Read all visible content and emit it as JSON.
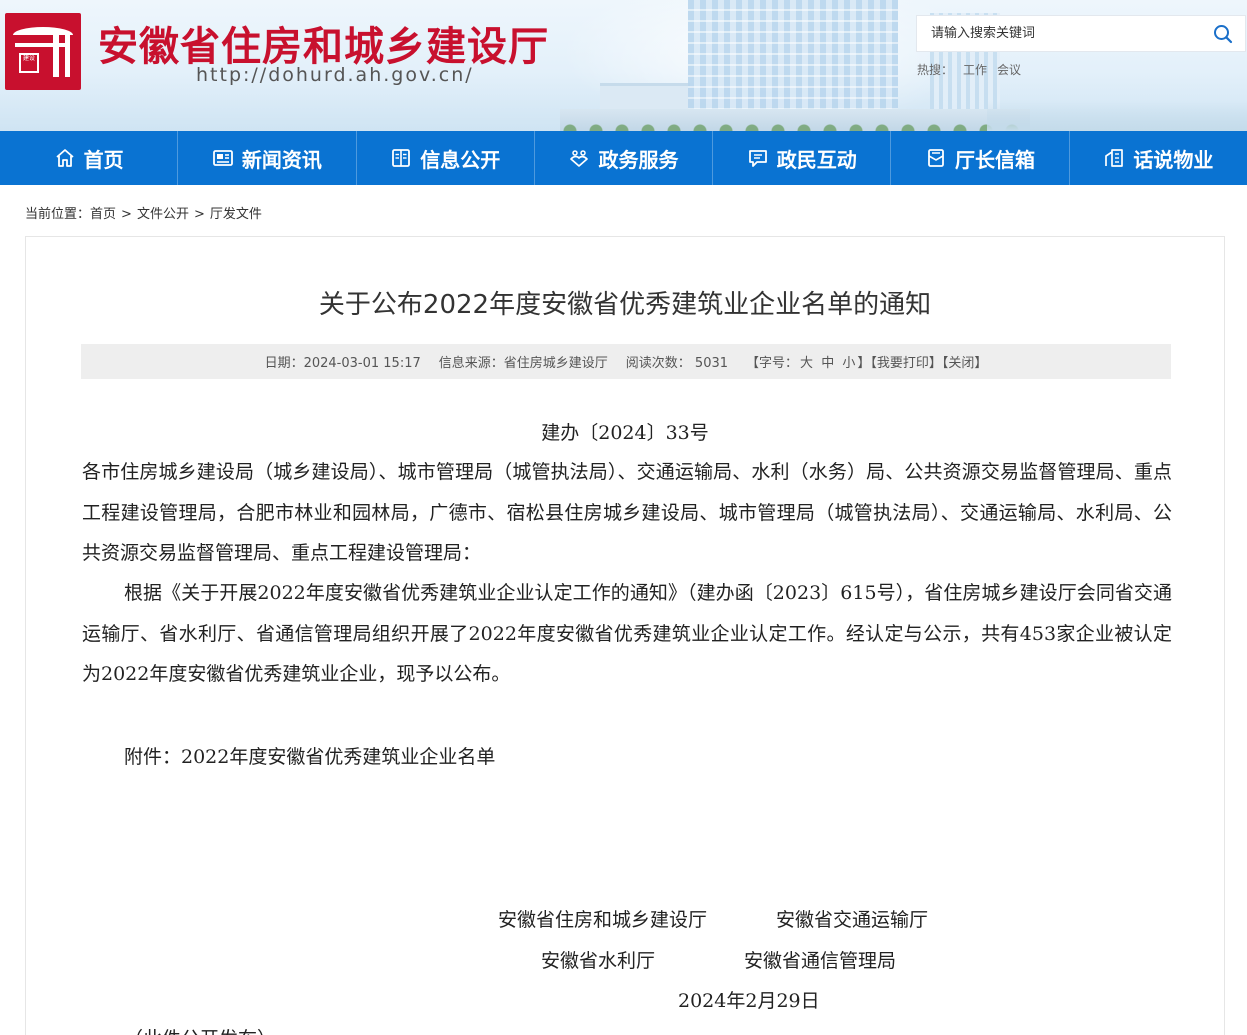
{
  "header": {
    "site_title": "安徽省住房和城乡建设厅",
    "site_url": "http://dohurd.ah.gov.cn/",
    "logo_seal_text": "建设",
    "search": {
      "placeholder": "请输入搜索关键词",
      "icon": "search-icon"
    },
    "hot": {
      "label": "热搜：",
      "items": [
        "工作",
        "会议"
      ]
    }
  },
  "nav": {
    "items": [
      {
        "label": "首页",
        "icon": "home-icon"
      },
      {
        "label": "新闻资讯",
        "icon": "news-icon"
      },
      {
        "label": "信息公开",
        "icon": "document-icon"
      },
      {
        "label": "政务服务",
        "icon": "service-icon"
      },
      {
        "label": "政民互动",
        "icon": "chat-icon"
      },
      {
        "label": "厅长信箱",
        "icon": "mailbox-icon"
      },
      {
        "label": "话说物业",
        "icon": "building-icon"
      }
    ],
    "colors": {
      "bar": "#0a73d2",
      "text": "#ffffff"
    }
  },
  "breadcrumb": {
    "prefix": "当前位置：",
    "items": [
      "首页",
      "文件公开",
      "厅发文件"
    ],
    "separator": ">"
  },
  "article": {
    "title": "关于公布2022年度安徽省优秀建筑业企业名单的通知",
    "meta": {
      "date": "日期：2024-03-01 15:17",
      "source": "信息来源：省住房城乡建设厅",
      "views_label": "阅读次数：",
      "views": "5031",
      "font_size_label": "【字号：",
      "font_sizes": [
        "大",
        "中",
        "小"
      ],
      "font_size_end": "】",
      "print": "【我要打印】",
      "close": "【关闭】"
    },
    "doc_number": "建办〔2024〕33号",
    "recipients": "各市住房城乡建设局（城乡建设局）、城市管理局（城管执法局）、交通运输局、水利（水务）局、公共资源交易监督管理局、重点工程建设管理局，合肥市林业和园林局，广德市、宿松县住房城乡建设局、城市管理局（城管执法局）、交通运输局、水利局、公共资源交易监督管理局、重点工程建设管理局：",
    "body": "根据《关于开展2022年度安徽省优秀建筑业企业认定工作的通知》（建办函〔2023〕615号），省住房城乡建设厅会同省交通运输厅、省水利厅、省通信管理局组织开展了2022年度安徽省优秀建筑业企业认定工作。经认定与公示，共有453家企业被认定为2022年度安徽省优秀建筑业企业，现予以公布。",
    "attachment": "附件：2022年度安徽省优秀建筑业企业名单",
    "signatories": [
      "安徽省住房和城乡建设厅",
      "安徽省交通运输厅",
      "安徽省水利厅",
      "安徽省通信管理局"
    ],
    "sign_date": "2024年2月29日",
    "note": "（此件公开发布）"
  },
  "colors": {
    "brand_red": "#c8102e",
    "meta_bg": "#eeeeee"
  }
}
